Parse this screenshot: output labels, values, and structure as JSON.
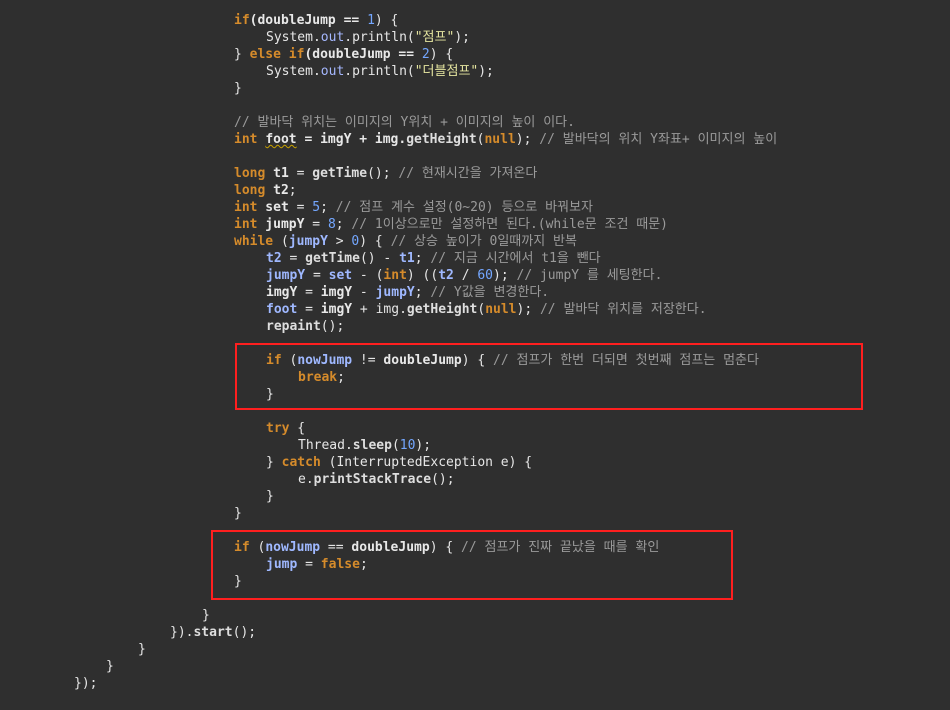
{
  "code": {
    "l1": {
      "kw": "if",
      "a": "(doubleJump == ",
      "n": "1",
      "b": ") {"
    },
    "l2": {
      "a": "System.",
      "f": "out",
      "b": ".println(",
      "s": "\"점프\"",
      "c": ");"
    },
    "l3": {
      "a": "} ",
      "kw": "else if",
      "b": "(doubleJump == ",
      "n": "2",
      "c": ") {"
    },
    "l4": {
      "a": "System.",
      "f": "out",
      "b": ".println(",
      "s": "\"더블점프\"",
      "c": ");"
    },
    "l5": {
      "a": "}"
    },
    "l6": {
      "cm": "// 발바닥 위치는 이미지의 Y위치 + 이미지의 높이 이다."
    },
    "l7": {
      "t": "int",
      "v": "foot",
      "a": " = imgY + img.",
      "fn": "getHeight",
      "b": "(",
      "n": "null",
      "c": "); ",
      "cm": "// 발바닥의 위치 Y좌표+ 이미지의 높이"
    },
    "l8": {
      "t": "long",
      "v": " t1",
      "a": " = ",
      "fn": "getTime",
      "b": "(); ",
      "cm": "// 현재시간을 가져온다"
    },
    "l9": {
      "t": "long",
      "v": " t2",
      "a": ";"
    },
    "l10": {
      "t": "int",
      "v": " set",
      "a": " = ",
      "n": "5",
      "b": "; ",
      "cm": "// 점프 계수 설정(0~20) 등으로 바꿔보자"
    },
    "l11": {
      "t": "int",
      "v": " jumpY",
      "a": " = ",
      "n": "8",
      "b": "; ",
      "cm": "// 1이상으로만 설정하면 된다.(while문 조건 때문)"
    },
    "l12": {
      "kw": "while",
      "a": " (",
      "v": "jumpY",
      "b": " > ",
      "n": "0",
      "c": ") { ",
      "cm": "// 상승 높이가 0일때까지 반복"
    },
    "l13": {
      "v": "t2",
      "a": " = ",
      "fn": "getTime",
      "b": "() - ",
      "v2": "t1",
      "c": "; ",
      "cm": "// 지금 시간에서 t1을 뺀다"
    },
    "l14": {
      "v": "jumpY",
      "a": " = ",
      "v2": "set",
      "b": " - (",
      "t": "int",
      "c": ") ((",
      "v3": "t2",
      "d": " / ",
      "n": "60",
      "e": "); ",
      "cm": "// jumpY 를 세팅한다."
    },
    "l15": {
      "v": "imgY",
      "a": " = ",
      "v2": "imgY",
      "b": " - ",
      "v3": "jumpY",
      "c": "; ",
      "cm": "// Y값을 변경한다."
    },
    "l16": {
      "v": "foot",
      "a": " = ",
      "v2": "imgY",
      "b": " + img.",
      "fn": "getHeight",
      "c": "(",
      "n": "null",
      "d": "); ",
      "cm": "// 발바닥 위치를 저장한다."
    },
    "l17": {
      "fn": "repaint",
      "a": "();"
    },
    "l18": {
      "kw": "if",
      "a": " (",
      "v": "nowJump",
      "b": " != ",
      "v2": "doubleJump",
      "c": ") { ",
      "cm": "// 점프가 한번 더되면 첫번째 점프는 멈춘다"
    },
    "l19": {
      "kw": "break",
      "a": ";"
    },
    "l20": {
      "a": "}"
    },
    "l21": {
      "kw": "try",
      "a": " {"
    },
    "l22": {
      "a": "Thread.",
      "fn": "sleep",
      "b": "(",
      "n": "10",
      "c": ");"
    },
    "l23": {
      "a": "} ",
      "kw": "catch",
      "b": " (InterruptedException e) {"
    },
    "l24": {
      "a": "e.",
      "fn": "printStackTrace",
      "b": "();"
    },
    "l25": {
      "a": "}"
    },
    "l26": {
      "a": "}"
    },
    "l27": {
      "kw": "if",
      "a": " (",
      "v": "nowJump",
      "b": " == ",
      "v2": "doubleJump",
      "c": ") { ",
      "cm": "// 점프가 진짜 끝났을 때를 확인"
    },
    "l28": {
      "v": "jump",
      "a": " = ",
      "kw": "false",
      "b": ";"
    },
    "l29": {
      "a": "}"
    },
    "l30": {
      "a": "}"
    },
    "l31": {
      "a": "}).",
      "fn": "start",
      "b": "();"
    },
    "l32": {
      "a": "}"
    },
    "l33": {
      "a": "}"
    },
    "l34": {
      "a": "});"
    }
  },
  "highlight_color": "#ff1f1f"
}
